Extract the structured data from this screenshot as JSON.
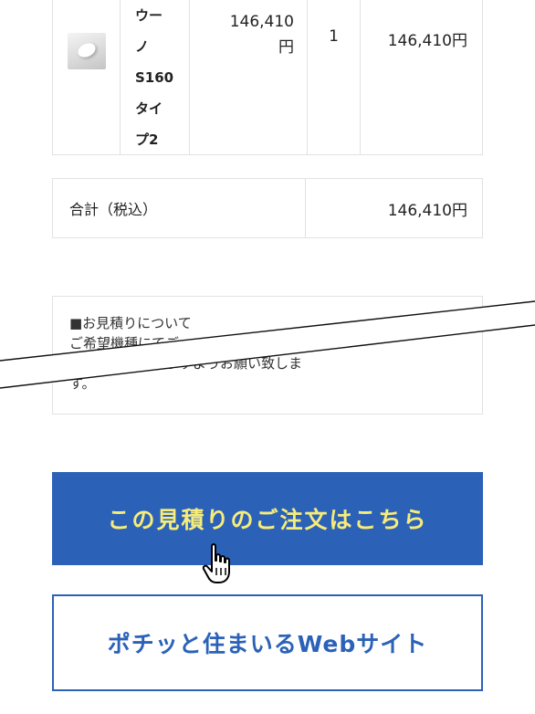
{
  "product_row": {
    "name_lines": [
      "ウー",
      "ノ",
      "S160",
      "タイ",
      "プ2"
    ],
    "unit_price_line1": "146,410",
    "unit_price_line2": "円",
    "quantity": "1",
    "subtotal": "146,410円"
  },
  "total": {
    "label": "合計（税込）",
    "value": "146,410円"
  },
  "note": {
    "heading": "■お見積りについて",
    "line1": "ご希望機種にてご",
    "line2": "　　　　　頂きますようお願い致しま",
    "line3": "す。"
  },
  "buttons": {
    "order_label": "この見積りのご注文はこちら",
    "website_label": "ポチッと住まいるWebサイト"
  },
  "colors": {
    "accent_blue": "#2b62b8",
    "order_text_yellow": "#f7ec7a"
  },
  "icons": {
    "cursor": "hand-pointer-icon",
    "product_thumbnail": "toilet-seat-thumbnail"
  }
}
